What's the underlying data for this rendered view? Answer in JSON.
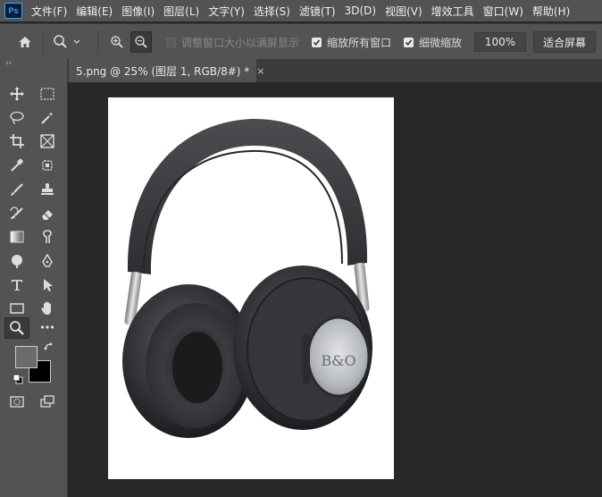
{
  "app": {
    "logo": "Ps"
  },
  "menu": [
    "文件(F)",
    "编辑(E)",
    "图像(I)",
    "图层(L)",
    "文字(Y)",
    "选择(S)",
    "滤镜(T)",
    "3D(D)",
    "视图(V)",
    "增效工具",
    "窗口(W)",
    "帮助(H)"
  ],
  "options": {
    "resize_windows_label": "调整窗口大小以满屏显示",
    "resize_windows_checked": false,
    "zoom_all_label": "缩放所有窗口",
    "zoom_all_checked": true,
    "scrubby_label": "细微缩放",
    "scrubby_checked": true,
    "zoom_percent": "100%",
    "fit_screen_label": "适合屏幕"
  },
  "document": {
    "tab_title": "5.png @ 25% (图层 1, RGB/8#) *",
    "close_glyph": "×"
  },
  "toolbar": {
    "collapse_glyph": "‹‹",
    "foreground_color": "#6b6b6b",
    "background_color": "#000000"
  },
  "colors": {
    "ui_panel": "#535353",
    "workspace": "#282828",
    "canvas": "#ffffff"
  }
}
